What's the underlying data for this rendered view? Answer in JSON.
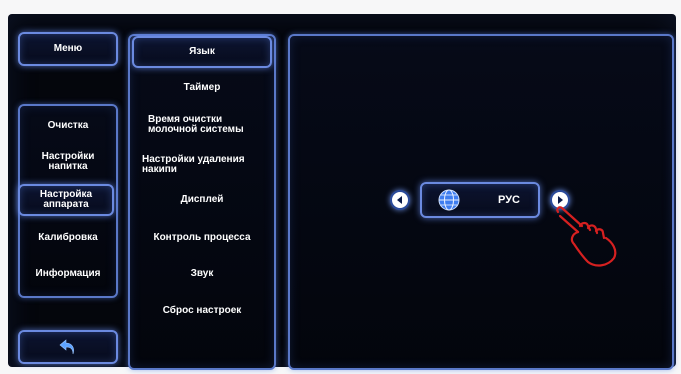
{
  "menu": {
    "title": "Меню",
    "items": [
      "Очистка",
      "Настройки напитка",
      "Настройка аппарата",
      "Калибровка",
      "Информация"
    ]
  },
  "submenu": {
    "items": [
      "Язык",
      "Таймер",
      "Время очистки молочной системы",
      "Настройки удаления накипи",
      "Дисплей",
      "Контроль процесса",
      "Звук",
      "Сброс настроек"
    ]
  },
  "language_selector": {
    "value": "РУС",
    "icon": "globe-icon"
  },
  "icons": {
    "back": "back-arrow-icon",
    "prev": "left-arrow-icon",
    "next": "right-arrow-icon",
    "pointer": "hand-pointer-icon"
  },
  "colors": {
    "accent": "#5a78c8",
    "background": "#04060c",
    "pointer": "#d62020"
  }
}
